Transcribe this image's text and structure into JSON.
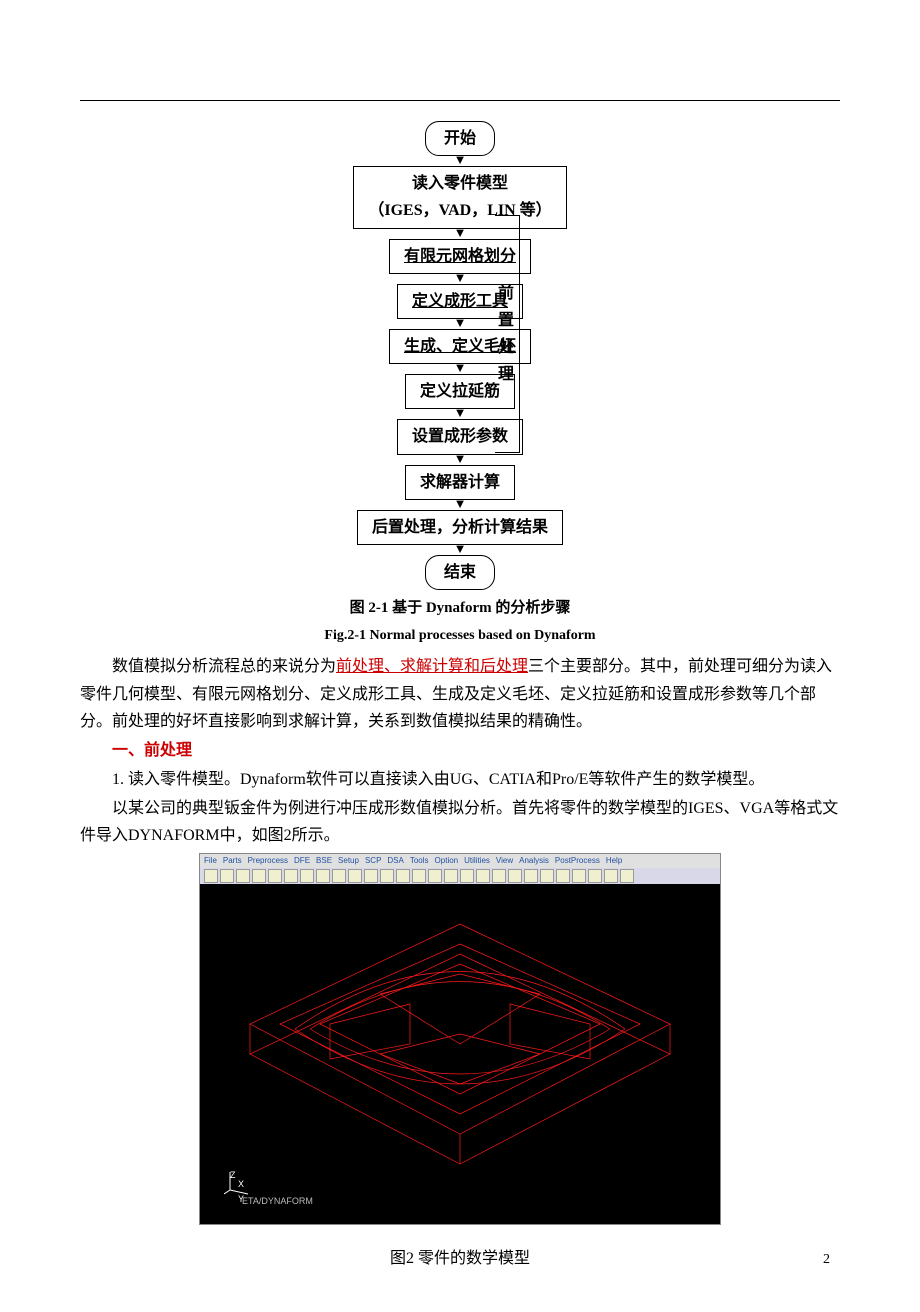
{
  "flow": {
    "start": "开始",
    "n1": "读入零件模型",
    "n1b": "（IGES，VAD，LIN 等）",
    "n2": "有限元网格划分",
    "n3": "定义成形工具",
    "n4": "生成、定义毛坯",
    "n5": "定义拉延筋",
    "n6": "设置成形参数",
    "n7": "求解器计算",
    "n8": "后置处理，分析计算结果",
    "end": "结束",
    "side": "前置处理"
  },
  "captions": {
    "fig21_cn": "图 2-1  基于 Dynaform 的分析步骤",
    "fig21_en": "Fig.2-1 Normal processes based on Dynaform",
    "fig2": "图2 零件的数学模型"
  },
  "body": {
    "p1_a": "数值模拟分析流程总的来说分为",
    "p1_link": "前处理、求解计算和后处理",
    "p1_b": "三个主要部分。其中，前处理可细分为读入零件几何模型、有限元网格划分、定义成形工具、生成及定义毛坯、定义拉延筋和设置成形参数等几个部分。前处理的好坏直接影响到求解计算，关系到数值模拟结果的精确性。",
    "sec1_title": "一、前处理",
    "li1": "1. 读入零件模型。Dynaform软件可以直接读入由UG、CATIA和Pro/E等软件产生的数学模型。",
    "p2": "以某公司的典型钣金件为例进行冲压成形数值模拟分析。首先将零件的数学模型的IGES、VGA等格式文件导入DYNAFORM中，如图2所示。"
  },
  "figmenu": [
    "File",
    "Parts",
    "Preprocess",
    "DFE",
    "BSE",
    "Setup",
    "SCP",
    "DSA",
    "Tools",
    "Option",
    "Utilities",
    "View",
    "Analysis",
    "PostProcess",
    "Help"
  ],
  "brand": "ETA/DYNAFORM",
  "page_number": "2"
}
